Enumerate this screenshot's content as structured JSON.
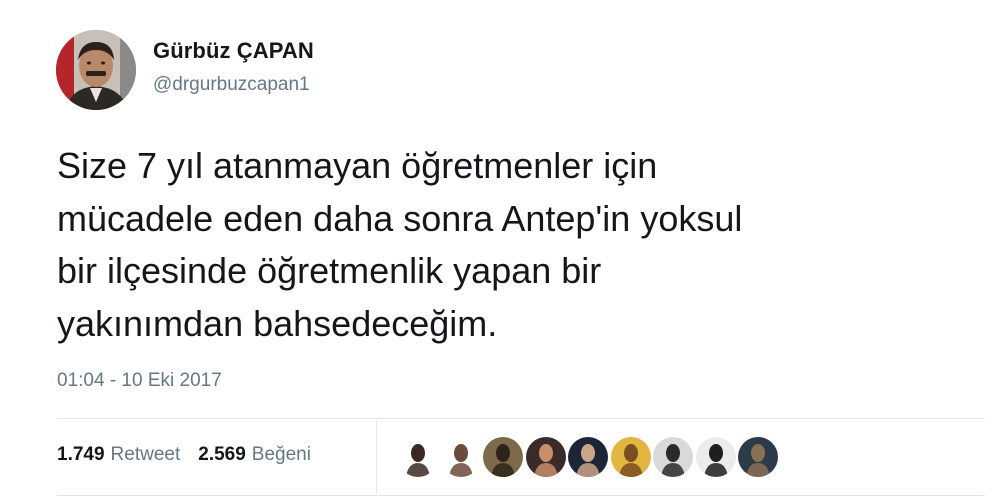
{
  "author": {
    "name": "Gürbüz ÇAPAN",
    "handle": "@drgurbuzcapan1"
  },
  "tweet": {
    "text": "Size 7 yıl atanmayan öğretmenler için\nmücadele eden daha sonra Antep'in yoksul\nbir ilçesinde öğretmenlik yapan bir\nyakınımdan bahsedeceğim.",
    "timestamp": "01:04 - 10 Eki 2017"
  },
  "stats": {
    "retweets": {
      "count": "1.749",
      "label": "Retweet"
    },
    "likes": {
      "count": "2.569",
      "label": "Beğeni"
    }
  },
  "likers": [
    {
      "icon": "liker-avatar-icon",
      "bg": "#ffffff",
      "fg": "#3a2a22"
    },
    {
      "icon": "liker-avatar-icon",
      "bg": "#ffffff",
      "fg": "#6b4b3a"
    },
    {
      "icon": "liker-avatar-icon",
      "bg": "#7d6a4a",
      "fg": "#2c241a"
    },
    {
      "icon": "liker-avatar-icon",
      "bg": "#3a2a2a",
      "fg": "#c98d6a"
    },
    {
      "icon": "liker-avatar-icon",
      "bg": "#1c2636",
      "fg": "#c9a58a"
    },
    {
      "icon": "liker-avatar-icon",
      "bg": "#e2b640",
      "fg": "#7a4e1e"
    },
    {
      "icon": "liker-avatar-icon",
      "bg": "#d9d9d9",
      "fg": "#2a2a2a"
    },
    {
      "icon": "liker-avatar-icon",
      "bg": "#ececec",
      "fg": "#1f1f1f"
    },
    {
      "icon": "liker-avatar-icon",
      "bg": "#2d3a4a",
      "fg": "#8a7055"
    }
  ],
  "colors": {
    "text": "#14171a",
    "secondary": "#657786",
    "divider": "#e1e8ed"
  }
}
